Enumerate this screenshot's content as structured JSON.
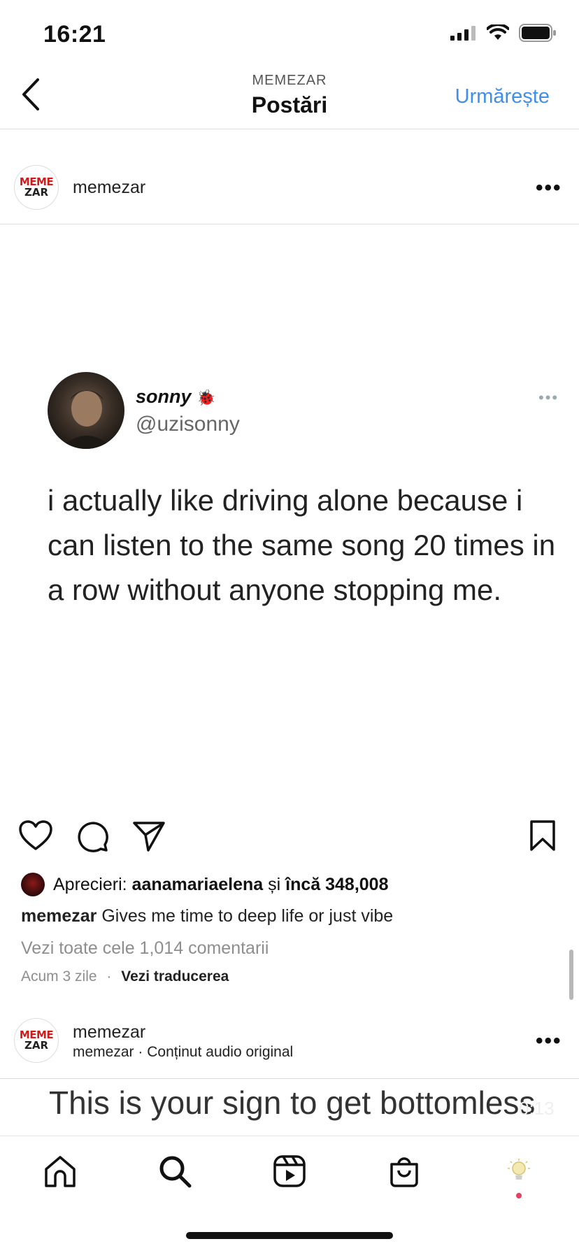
{
  "status_bar": {
    "time": "16:21"
  },
  "header": {
    "subtitle": "MEMEZAR",
    "title": "Postări",
    "follow_label": "Urmărește"
  },
  "post": {
    "username": "memezar",
    "avatar_line1": "MEME",
    "avatar_line2": "ZAR",
    "more_label": "•••",
    "tweet": {
      "name": "sonny",
      "name_emoji": "🐞",
      "handle": "@uzisonny",
      "text": "i actually like driving alone because i can listen to the same song 20 times in a row without anyone stopping me."
    },
    "likes_prefix": "Aprecieri:",
    "likes_user": "aanamariaelena",
    "likes_and": "și",
    "likes_more": "încă 348,008",
    "caption_user": "memezar",
    "caption_text": "Gives me time to deep life or just vibe",
    "view_comments": "Vezi toate cele 1,014 comentarii",
    "time_ago": "Acum 3 zile",
    "separator": "·",
    "translate_label": "Vezi traducerea"
  },
  "next_post": {
    "username": "memezar",
    "audio_user": "memezar",
    "audio_label": "Conținut audio original",
    "overlay_text": "This is your sign to get bottomless",
    "timer": "0:13"
  },
  "icons": {
    "back": "chevron-left-icon",
    "like": "heart-icon",
    "comment": "comment-icon",
    "share": "send-icon",
    "save": "bookmark-icon",
    "home": "home-icon",
    "search": "search-icon",
    "reels": "reels-icon",
    "shop": "shop-icon",
    "profile": "profile-avatar-icon"
  },
  "colors": {
    "accent": "#3f8fe8",
    "notification": "#e4405f"
  }
}
